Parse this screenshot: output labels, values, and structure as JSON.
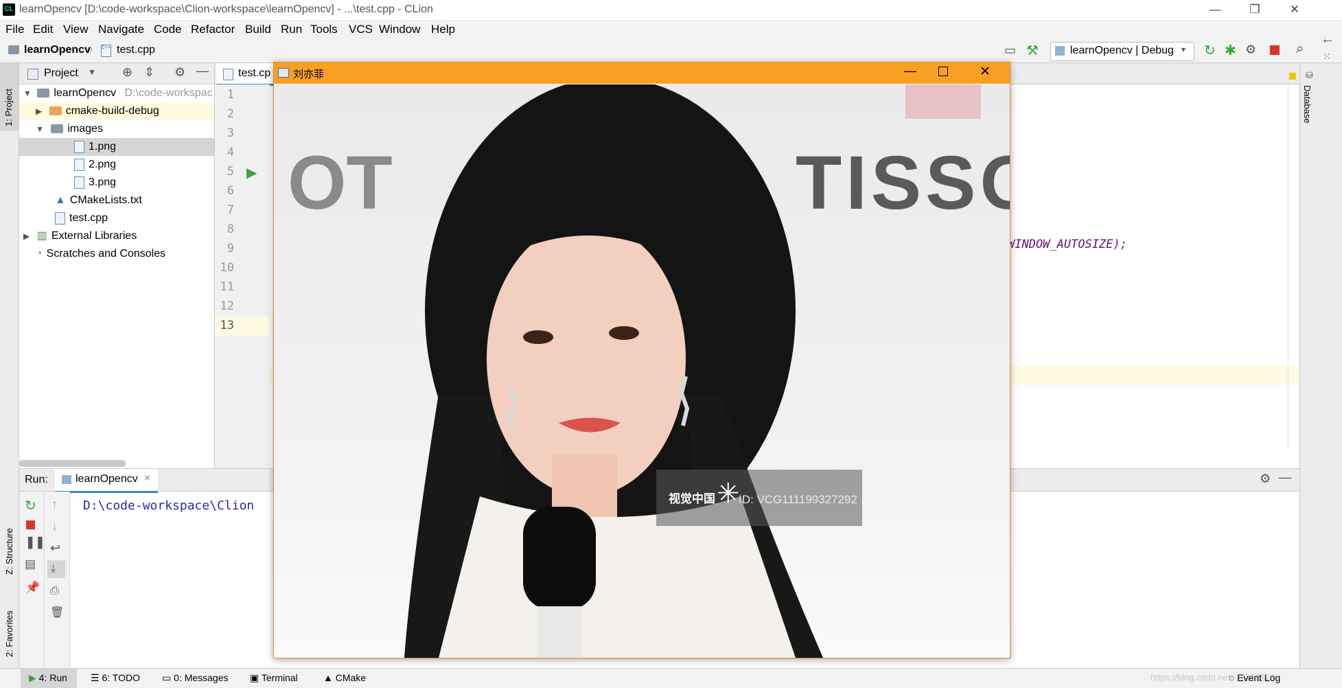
{
  "window": {
    "title": "learnOpencv [D:\\code-workspace\\Clion-workspace\\learnOpencv] - ...\\test.cpp - CLion",
    "app_icon_text": "CL",
    "minimize": "—",
    "restore": "❐",
    "close": "✕"
  },
  "menu": [
    "File",
    "Edit",
    "View",
    "Navigate",
    "Code",
    "Refactor",
    "Build",
    "Run",
    "Tools",
    "VCS",
    "Window",
    "Help"
  ],
  "breadcrumb": {
    "project": "learnOpencv",
    "file": "test.cpp"
  },
  "toolbar": {
    "run_config": "learnOpencv | Debug"
  },
  "left_stripe": {
    "project_tab": "1: Project",
    "structure_tab": "Z: Structure",
    "favorites_tab": "2: Favorites"
  },
  "right_stripe": {
    "database_tab": "Database"
  },
  "project_panel": {
    "title": "Project",
    "tree": [
      {
        "label": "learnOpencv",
        "path": "D:\\code-workspac",
        "indent": 0,
        "type": "module",
        "expanded": true
      },
      {
        "label": "cmake-build-debug",
        "indent": 1,
        "type": "folder-orange",
        "expanded": false
      },
      {
        "label": "images",
        "indent": 1,
        "type": "folder",
        "expanded": true
      },
      {
        "label": "1.png",
        "indent": 2,
        "type": "image",
        "selected": true
      },
      {
        "label": "2.png",
        "indent": 2,
        "type": "image"
      },
      {
        "label": "3.png",
        "indent": 2,
        "type": "image"
      },
      {
        "label": "CMakeLists.txt",
        "indent": 1,
        "type": "cmake"
      },
      {
        "label": "test.cpp",
        "indent": 1,
        "type": "cpp"
      },
      {
        "label": "External Libraries",
        "indent": 0,
        "type": "libs",
        "expanded": false
      },
      {
        "label": "Scratches and Consoles",
        "indent": 0,
        "type": "scratch"
      }
    ]
  },
  "editor": {
    "tab_label": "test.cp",
    "line_numbers": [
      "1",
      "2",
      "3",
      "4",
      "5",
      "6",
      "7",
      "8",
      "9",
      "10",
      "11",
      "12",
      "13"
    ],
    "visible_code_fragment": "WINDOW_AUTOSIZE);"
  },
  "run_panel": {
    "label": "Run:",
    "tab_label": "learnOpencv",
    "tab_close": "×",
    "output": "D:\\code-workspace\\Clion"
  },
  "status_bar": {
    "items": [
      "4: Run",
      "6: TODO",
      "0: Messages",
      "Terminal",
      "CMake"
    ],
    "event_log": "Event Log",
    "watermark": "https://blog.csdn.net/...2312323"
  },
  "image_window": {
    "title": "刘亦菲",
    "photo_watermark_brand": "视觉中国",
    "photo_watermark_id": "ID: VCG111199327292",
    "backdrop_text_1": "TISSO",
    "backdrop_text_2": "OT"
  },
  "colors": {
    "image_window_titlebar": "#f8a023",
    "run_green": "#3aa43a",
    "stop_red": "#d9362b",
    "selection": "#d5d5d5",
    "current_line": "#fffae3"
  }
}
